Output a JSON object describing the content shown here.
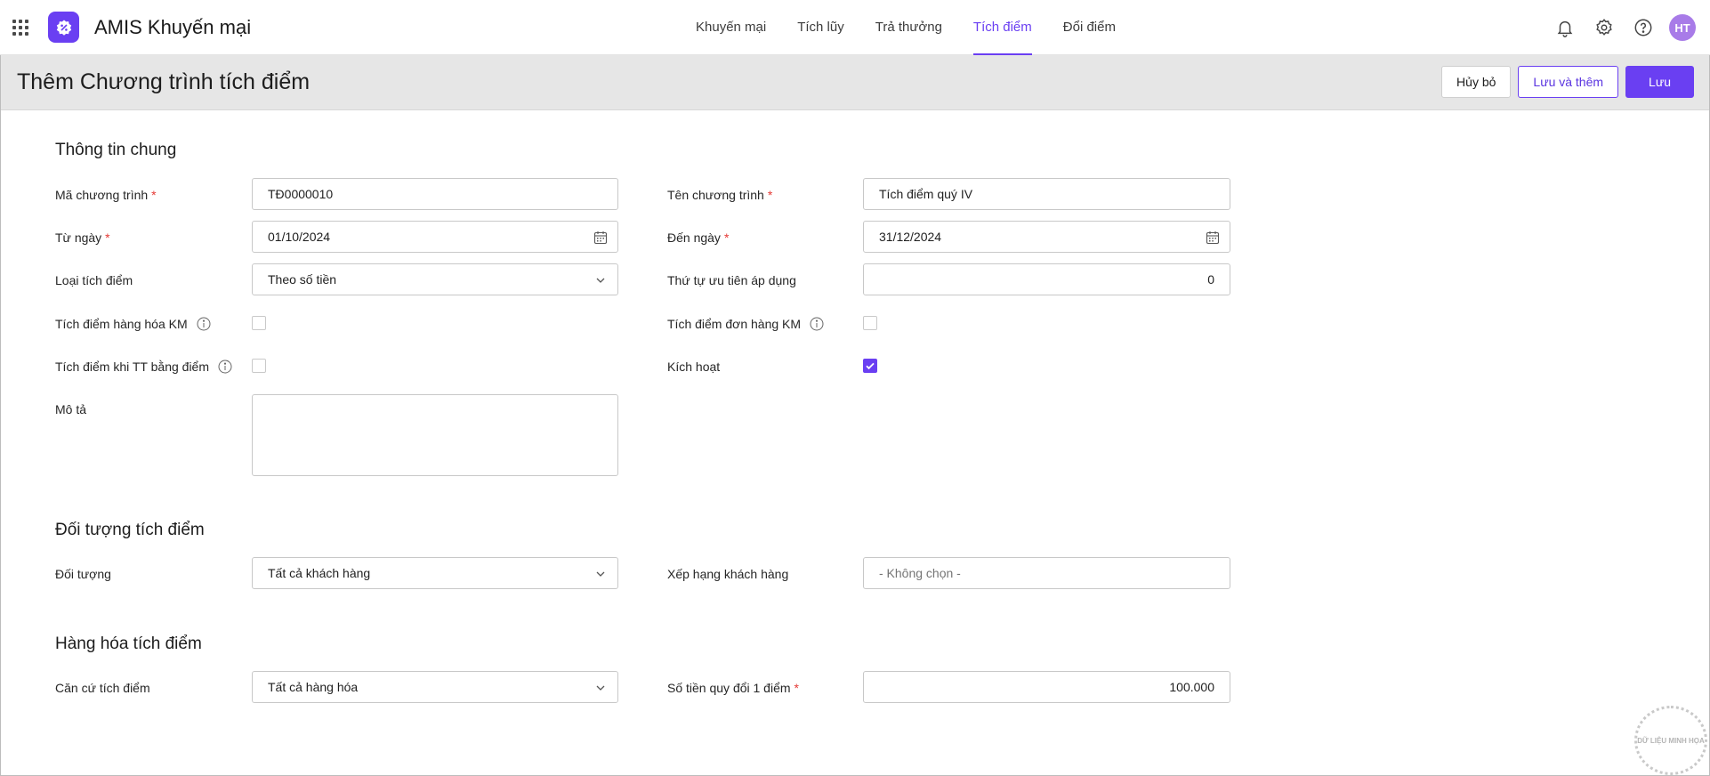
{
  "app": {
    "title": "AMIS Khuyến mại",
    "user_initials": "HT"
  },
  "nav": {
    "items": [
      {
        "label": "Khuyến mại"
      },
      {
        "label": "Tích lũy"
      },
      {
        "label": "Trả thưởng"
      },
      {
        "label": "Tích điểm",
        "active": true
      },
      {
        "label": "Đổi điểm"
      }
    ]
  },
  "header": {
    "title": "Thêm Chương trình tích điểm"
  },
  "toolbar": {
    "cancel_label": "Hủy bỏ",
    "save_add_label": "Lưu và thêm",
    "save_label": "Lưu"
  },
  "general": {
    "section_title": "Thông tin chung",
    "program_code": {
      "label": "Mã chương trình",
      "value": "TĐ0000010"
    },
    "program_name": {
      "label": "Tên chương trình",
      "value": "Tích điểm quý IV"
    },
    "from_date": {
      "label": "Từ ngày",
      "value": "01/10/2024"
    },
    "to_date": {
      "label": "Đến ngày",
      "value": "31/12/2024"
    },
    "point_type": {
      "label": "Loại tích điểm",
      "value": "Theo số tiền"
    },
    "priority": {
      "label": "Thứ tự ưu tiên áp dụng",
      "value": "0"
    },
    "promo_goods": {
      "label": "Tích điểm hàng hóa KM",
      "checked": false
    },
    "promo_orders": {
      "label": "Tích điểm đơn hàng KM",
      "checked": false
    },
    "pay_by_points": {
      "label": "Tích điểm khi TT bằng điểm",
      "checked": false
    },
    "active": {
      "label": "Kích hoạt",
      "checked": true
    },
    "description": {
      "label": "Mô tả",
      "value": ""
    }
  },
  "target": {
    "section_title": "Đối tượng tích điểm",
    "object": {
      "label": "Đối tượng",
      "value": "Tất cả khách hàng"
    },
    "rank": {
      "label": "Xếp hạng khách hàng",
      "placeholder": "- Không chọn -"
    }
  },
  "goods": {
    "section_title": "Hàng hóa tích điểm",
    "basis": {
      "label": "Căn cứ tích điểm",
      "value": "Tất cả hàng hóa"
    },
    "amount_per_point": {
      "label": "Số tiền quy đổi 1 điểm",
      "value": "100.000"
    }
  },
  "watermark": {
    "text": "DỮ LIỆU MINH HỌA"
  },
  "colors": {
    "accent": "#6a3ff2",
    "required": "#e53935",
    "titlebar_bg": "#e6e6e6"
  }
}
